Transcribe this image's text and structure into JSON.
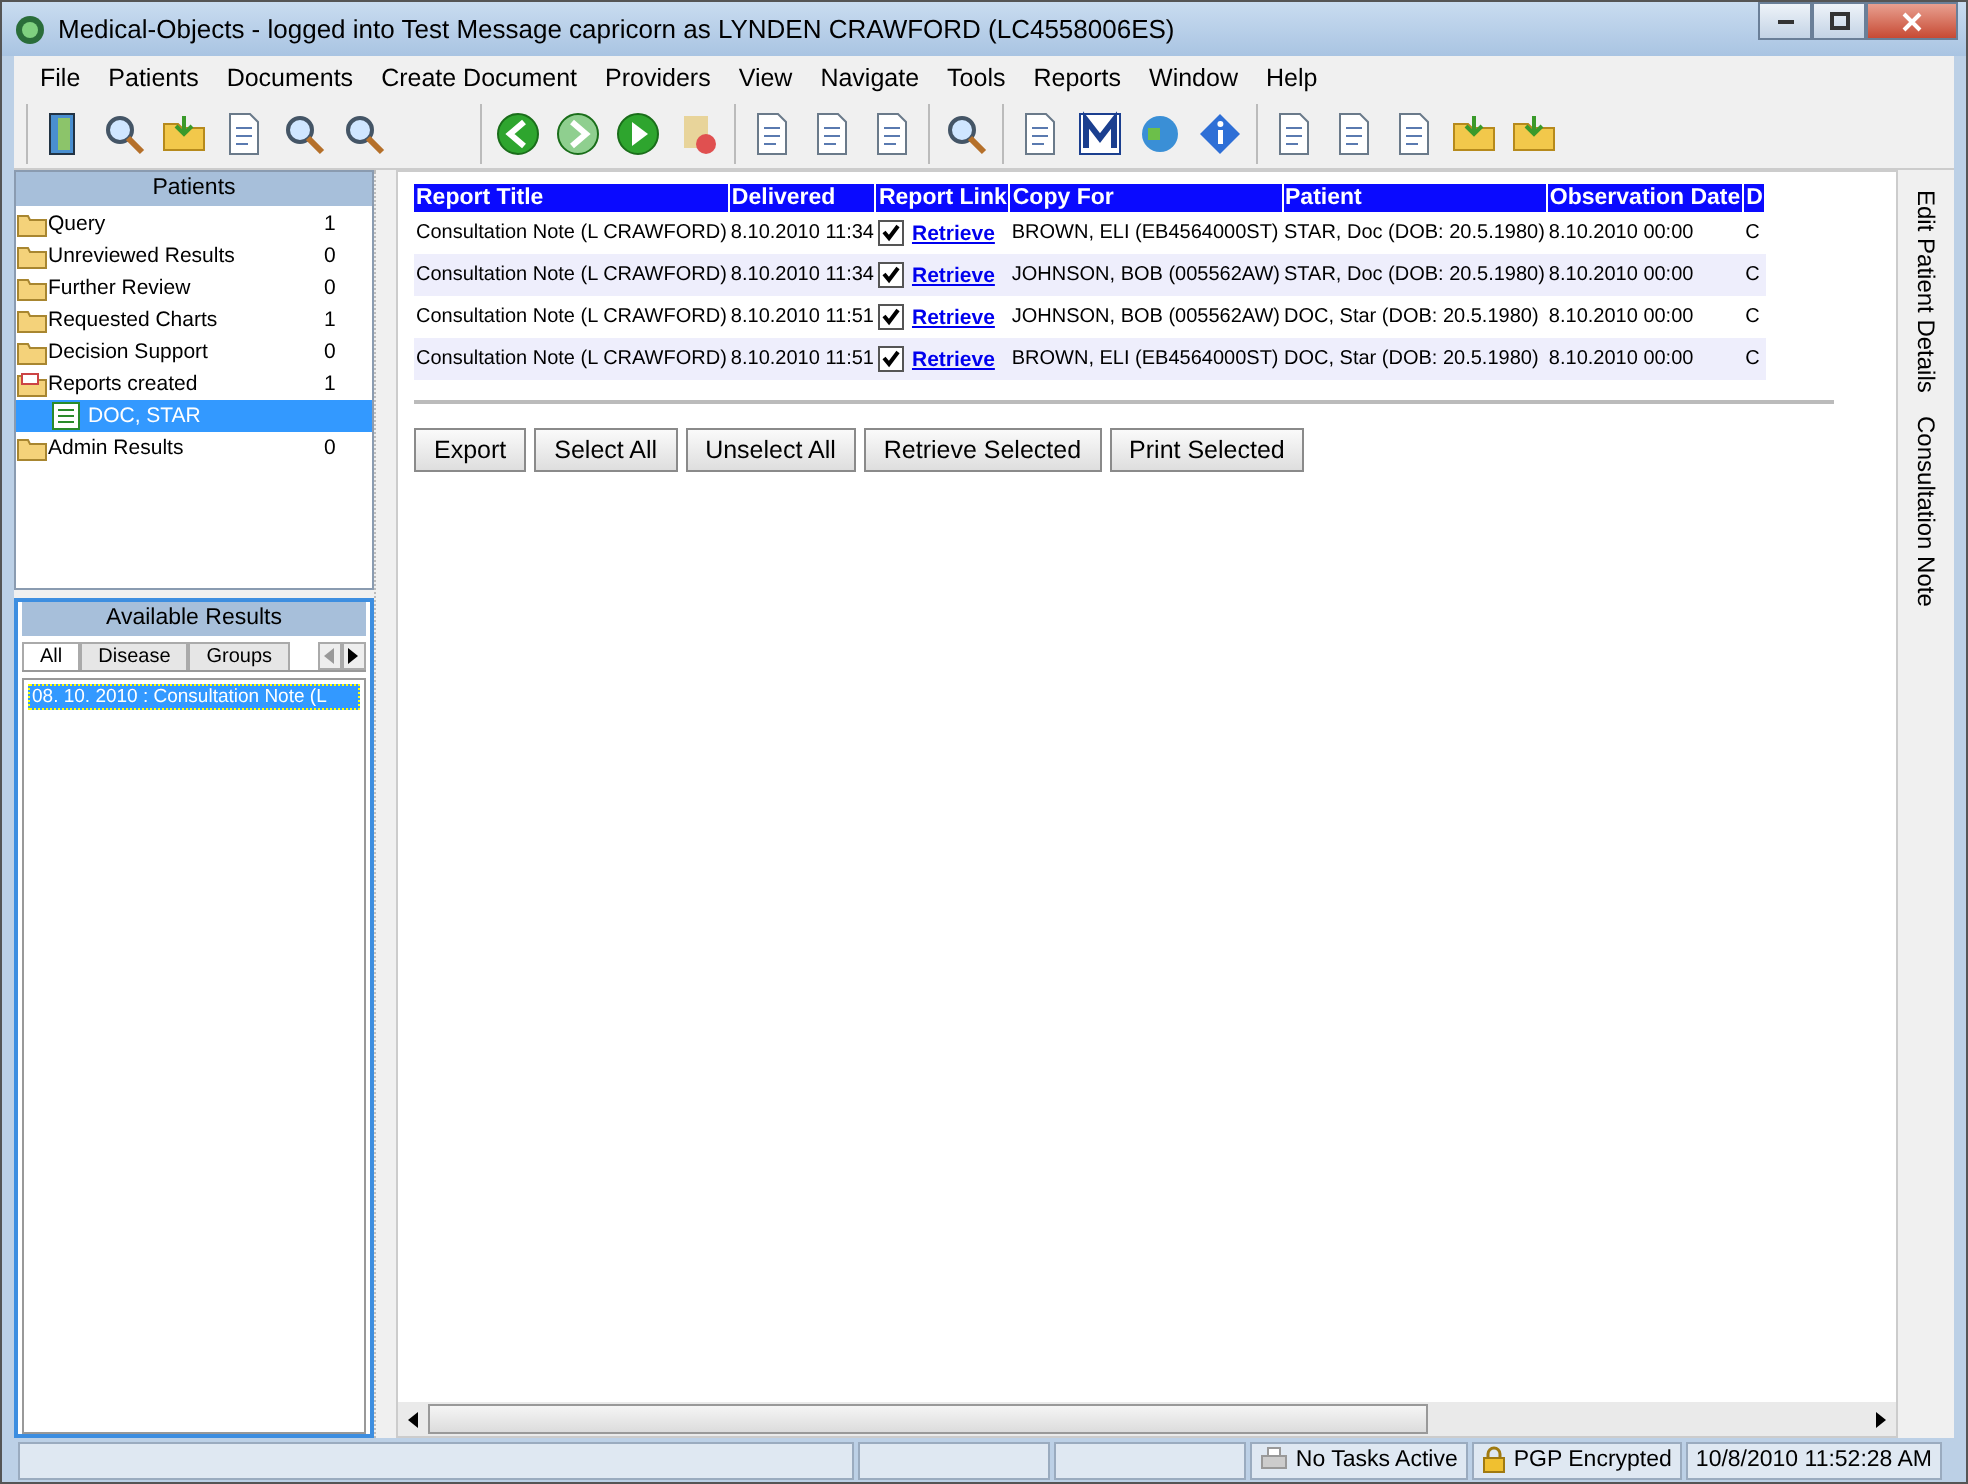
{
  "window": {
    "title": "Medical-Objects - logged into Test Message capricorn as LYNDEN CRAWFORD (LC4558006ES)"
  },
  "menu": [
    "File",
    "Patients",
    "Documents",
    "Create Document",
    "Providers",
    "View",
    "Navigate",
    "Tools",
    "Reports",
    "Window",
    "Help"
  ],
  "patients_panel": {
    "title": "Patients",
    "items": [
      {
        "label": "Query",
        "count": "1",
        "expanded": false
      },
      {
        "label": "Unreviewed Results",
        "count": "0",
        "expanded": false
      },
      {
        "label": "Further Review",
        "count": "0",
        "expanded": false
      },
      {
        "label": "Requested Charts",
        "count": "1",
        "expanded": false
      },
      {
        "label": "Decision Support",
        "count": "0",
        "expanded": false
      },
      {
        "label": "Reports created",
        "count": "1",
        "expanded": true,
        "children": [
          {
            "label": "DOC, STAR",
            "selected": true
          }
        ]
      },
      {
        "label": "Admin Results",
        "count": "0",
        "expanded": false
      }
    ]
  },
  "results_panel": {
    "title": "Available Results",
    "tabs": [
      {
        "label": "All",
        "selected": true
      },
      {
        "label": "Disease",
        "selected": false
      },
      {
        "label": "Groups",
        "selected": false
      }
    ],
    "items": [
      {
        "label": "08. 10. 2010 : Consultation Note (L",
        "selected": true
      }
    ]
  },
  "table": {
    "columns": [
      "Report Title",
      "Delivered",
      "Report Link",
      "Copy For",
      "Patient",
      "Observation Date",
      "D"
    ],
    "rows": [
      {
        "title": "Consultation Note (L CRAWFORD)",
        "delivered": "8.10.2010 11:34",
        "checked": true,
        "link": "Retrieve",
        "copy_for": "BROWN, ELI (EB4564000ST)",
        "patient": "STAR, Doc (DOB: 20.5.1980)",
        "observation_date": "8.10.2010 00:00",
        "column_7": "C"
      },
      {
        "title": "Consultation Note (L CRAWFORD)",
        "delivered": "8.10.2010 11:34",
        "checked": true,
        "link": "Retrieve",
        "copy_for": "JOHNSON, BOB (005562AW)",
        "patient": "STAR, Doc (DOB: 20.5.1980)",
        "observation_date": "8.10.2010 00:00",
        "column_7": "C"
      },
      {
        "title": "Consultation Note (L CRAWFORD)",
        "delivered": "8.10.2010 11:51",
        "checked": true,
        "link": "Retrieve",
        "copy_for": "JOHNSON, BOB (005562AW)",
        "patient": "DOC, Star (DOB: 20.5.1980)",
        "observation_date": "8.10.2010 00:00",
        "column_7": "C"
      },
      {
        "title": "Consultation Note (L CRAWFORD)",
        "delivered": "8.10.2010 11:51",
        "checked": true,
        "link": "Retrieve",
        "copy_for": "BROWN, ELI (EB4564000ST)",
        "patient": "DOC, Star (DOB: 20.5.1980)",
        "observation_date": "8.10.2010 00:00",
        "column_7": "C"
      }
    ]
  },
  "buttons": [
    "Export",
    "Select All",
    "Unselect All",
    "Retrieve Selected",
    "Print Selected"
  ],
  "side_tabs": [
    "Edit Patient Details",
    "Consultation Note"
  ],
  "status_bar": {
    "tasks": "No Tasks Active",
    "encryption": "PGP Encrypted",
    "datetime": "10/8/2010 11:52:28 AM"
  }
}
